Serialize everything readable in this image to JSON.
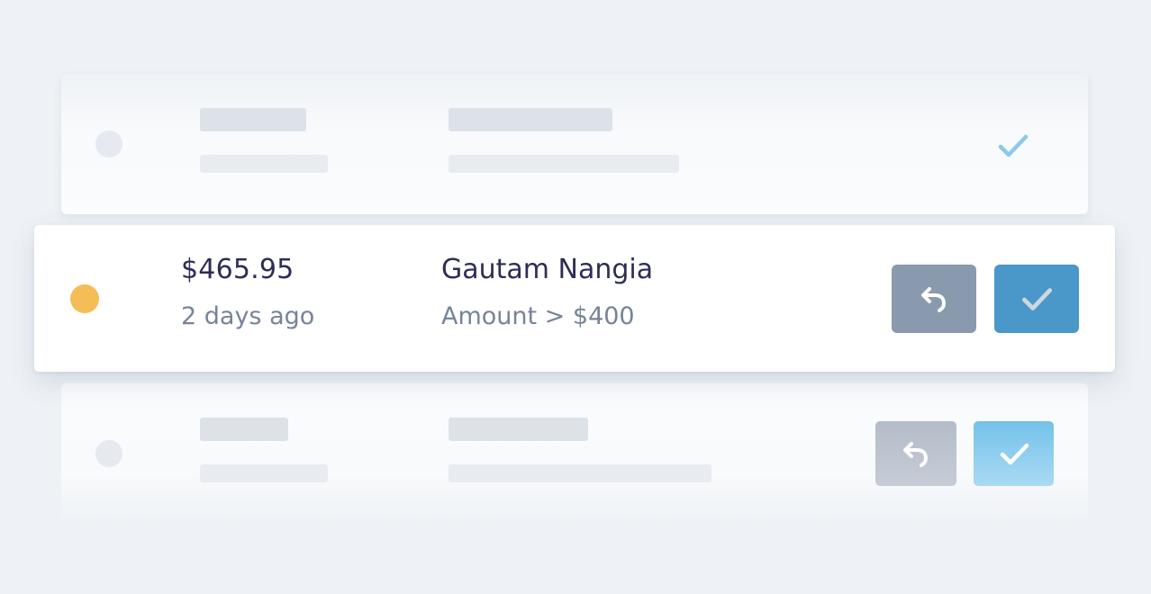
{
  "colors": {
    "background": "#eef2f6",
    "pending_status": "#f5bd55",
    "undo_button": "#8a9aae",
    "approve_button": "#4a98c9",
    "primary_text": "#2e2d56",
    "secondary_text": "#77839a"
  },
  "icons": {
    "undo": "undo-arrow-icon",
    "approve": "checkmark-icon"
  },
  "active_row": {
    "amount": "$465.95",
    "time": "2 days ago",
    "customer_name": "Gautam Nangia",
    "rule": "Amount > $400",
    "status": "pending"
  }
}
